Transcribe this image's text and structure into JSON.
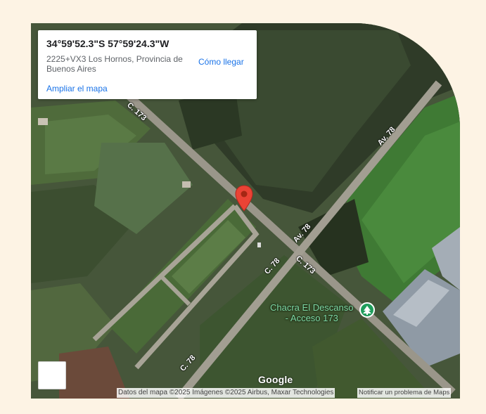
{
  "info_card": {
    "coordinates": "34°59'52.3\"S 57°59'24.3\"W",
    "address": "2225+VX3 Los Hornos, Provincia de Buenos Aires",
    "directions_label": "Cómo llegar",
    "enlarge_label": "Ampliar el mapa"
  },
  "roads": {
    "c173_top": "C. 173",
    "c173_mid": "C. 173",
    "av78_top": "Av. 78",
    "av78_mid": "Av. 78",
    "c78_mid": "C. 78",
    "c78_bottom": "C. 78"
  },
  "place": {
    "name_line1": "Chacra El Descanso",
    "name_line2": "- Acceso 173",
    "icon": "tree-icon"
  },
  "marker": {
    "icon": "map-pin-icon",
    "color": "#ea4335"
  },
  "footer": {
    "logo": "Google",
    "attribution": "Datos del mapa ©2025 Imágenes ©2025 Airbus, Maxar Technologies",
    "report_label": "Notificar un problema de Maps"
  },
  "colors": {
    "page_background": "#fdf3e4",
    "link": "#1a73e8",
    "place_label": "#7dd8a4",
    "marker": "#ea4335"
  }
}
